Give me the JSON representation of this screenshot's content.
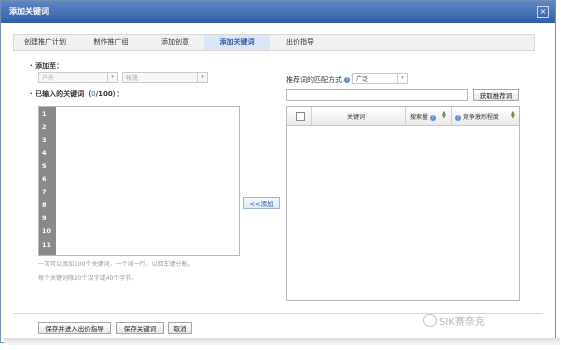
{
  "dialog": {
    "title": "添加关键词",
    "close_label": "×"
  },
  "steps": [
    {
      "label": "创建推广计划"
    },
    {
      "label": "制作推广组"
    },
    {
      "label": "添加创意"
    },
    {
      "label": "添加关键词"
    },
    {
      "label": "出价指导"
    }
  ],
  "add_to": {
    "label": "添加至：",
    "plan_select": "户外",
    "group_select": "帐篷"
  },
  "keyword_entry": {
    "label_prefix": "已输入的关键词（",
    "count": "0",
    "limit": "/100）：",
    "line_numbers": [
      "1",
      "2",
      "3",
      "4",
      "5",
      "6",
      "7",
      "8",
      "9",
      "10",
      "11"
    ],
    "hint_1": "一次可以添加100个关键词，一个词一行，以回车键分割。",
    "hint_2": "每个关键词限20个汉字或40个字节。"
  },
  "add_button": "<<添加",
  "recommend": {
    "match_label": "推荐词的匹配方式",
    "match_value": "广泛",
    "search_placeholder": "",
    "get_button": "获取推荐词",
    "columns": {
      "keyword": "关键词",
      "search_volume": "搜索量",
      "competition": "竞争激烈程度"
    }
  },
  "footer": {
    "save_and_bid": "保存并进入出价指导",
    "save_keywords": "保存关键词",
    "cancel": "取消"
  },
  "watermark": "SIK赛奈克"
}
